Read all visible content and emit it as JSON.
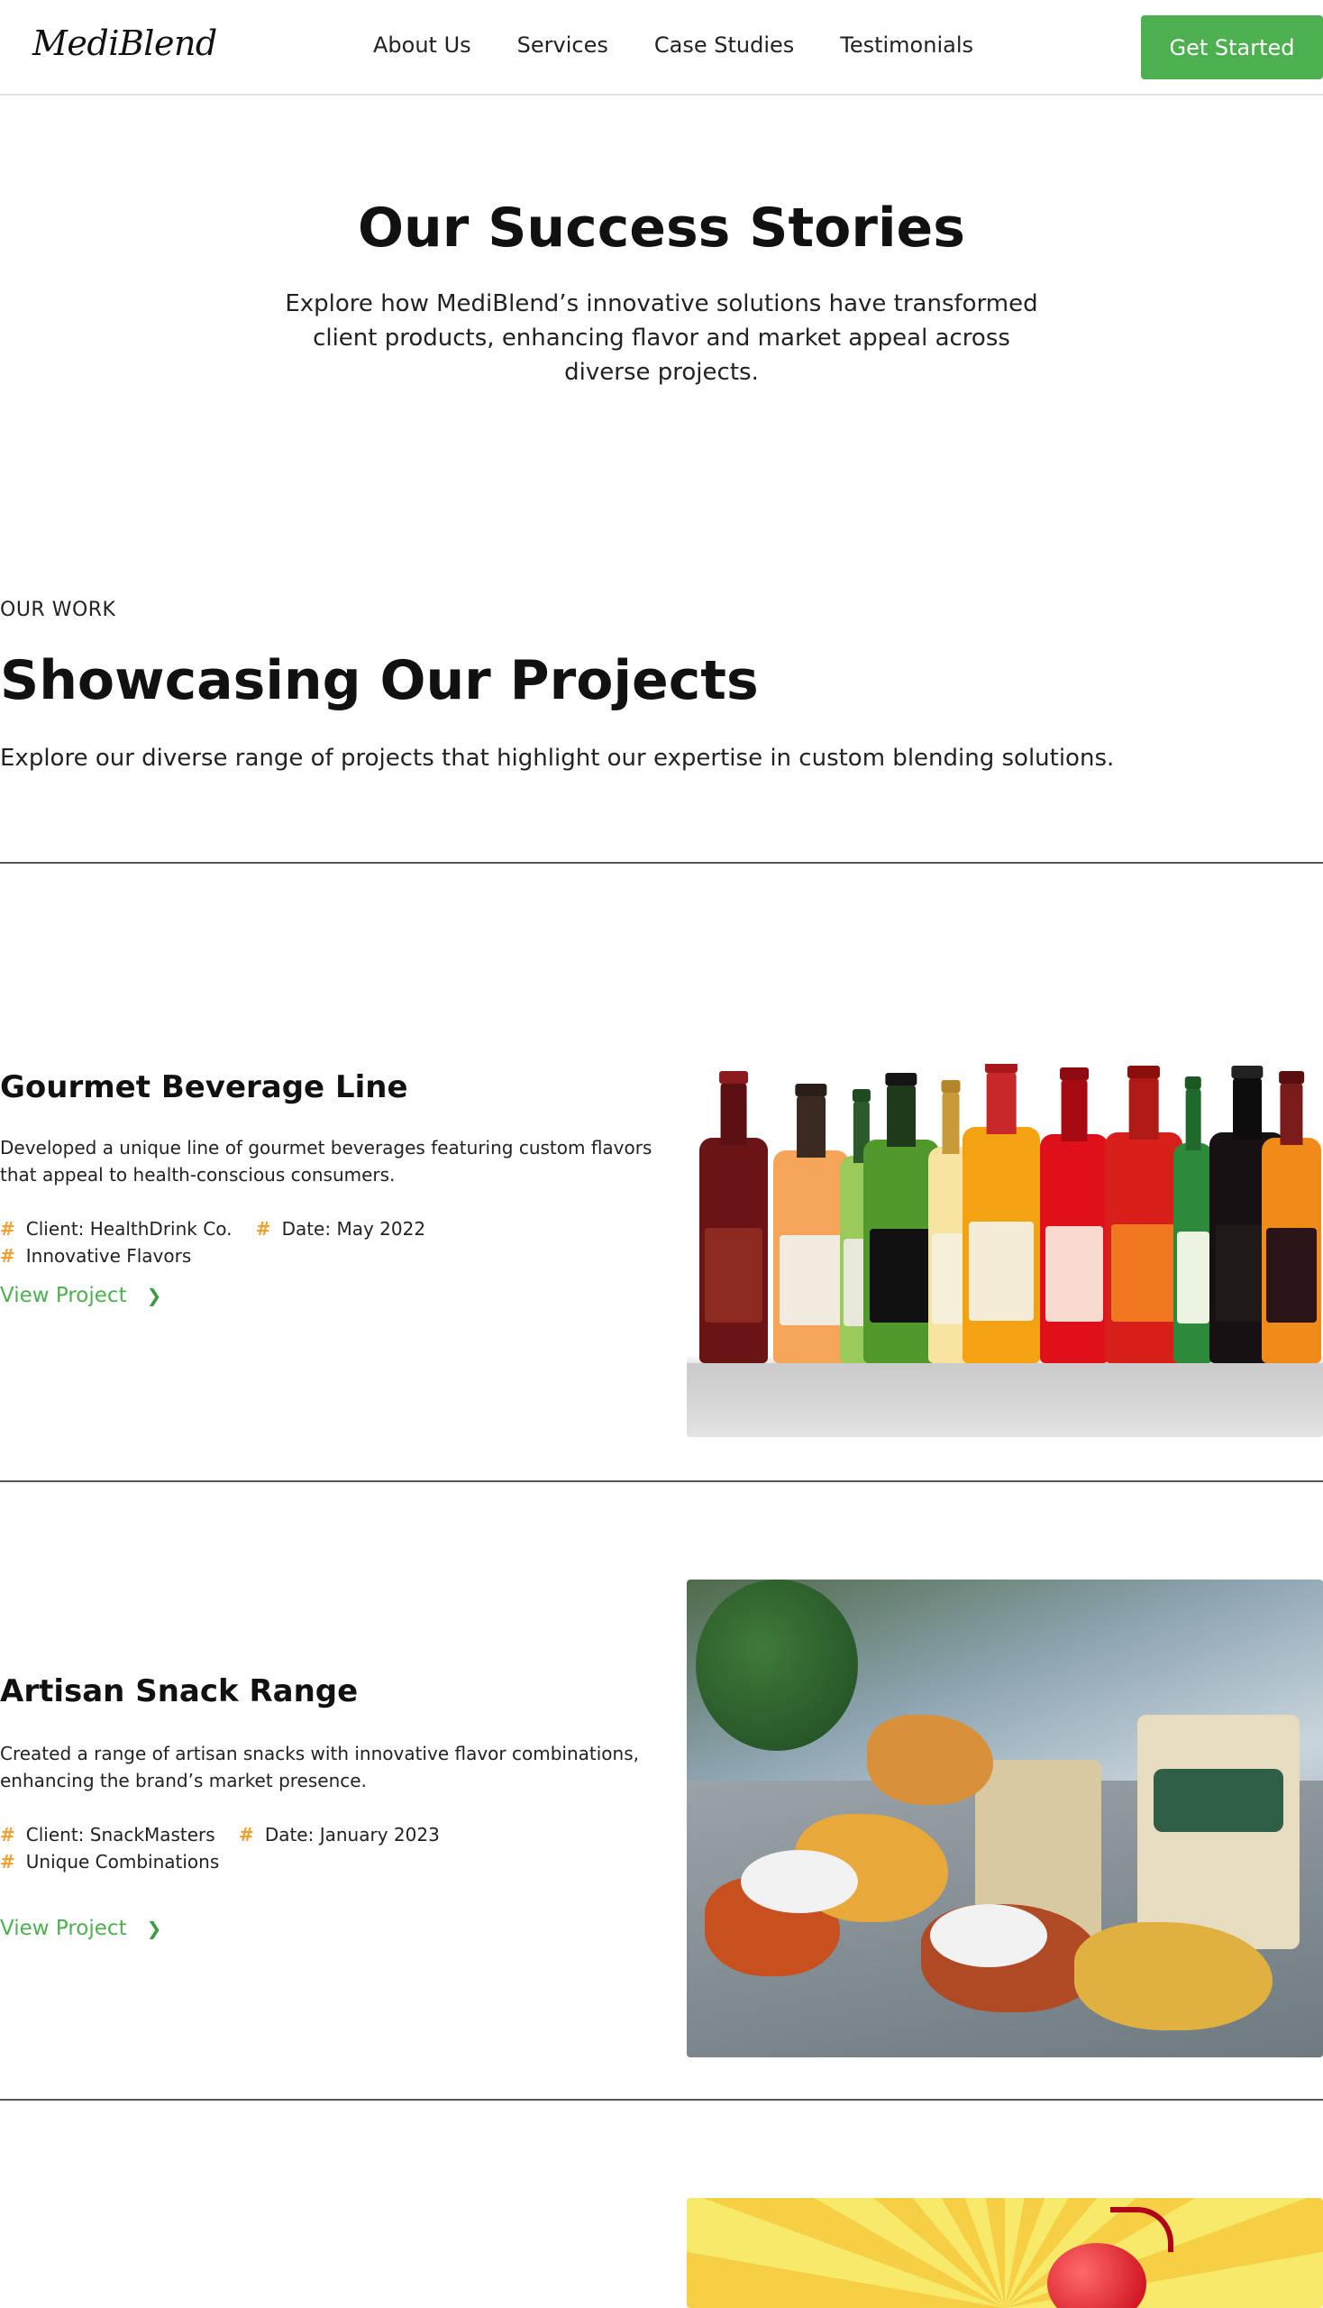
{
  "header": {
    "logo": "MediBlend",
    "nav": [
      "About Us",
      "Services",
      "Case Studies",
      "Testimonials"
    ],
    "cta": "Get Started"
  },
  "hero": {
    "title": "Our Success Stories",
    "subtitle": "Explore how MediBlend’s innovative solutions have transformed client products, enhancing flavor and market appeal across diverse projects."
  },
  "work": {
    "eyebrow": "OUR WORK",
    "title": "Showcasing Our Projects",
    "subtitle": "Explore our diverse range of projects that highlight our expertise in custom blending solutions."
  },
  "projects": [
    {
      "title": "Gourmet Beverage Line",
      "description": "Developed a unique line of gourmet beverages featuring custom flavors that appeal to health-conscious consumers.",
      "tags": [
        "Client: HealthDrink Co.",
        "Date: May 2022",
        "Innovative Flavors"
      ],
      "link": "View Project"
    },
    {
      "title": "Artisan Snack Range",
      "description": "Created a range of artisan snacks with innovative flavor combinations, enhancing the brand’s market presence.",
      "tags": [
        "Client: SnackMasters",
        "Date: January 2023",
        "Unique Combinations"
      ],
      "link": "View Project"
    }
  ],
  "colors": {
    "accent": "#4caf50",
    "tag_icon": "#f0a030",
    "divider": "#555555"
  },
  "icons": {
    "tag": "hash-icon",
    "link": "chevron-right-icon"
  }
}
